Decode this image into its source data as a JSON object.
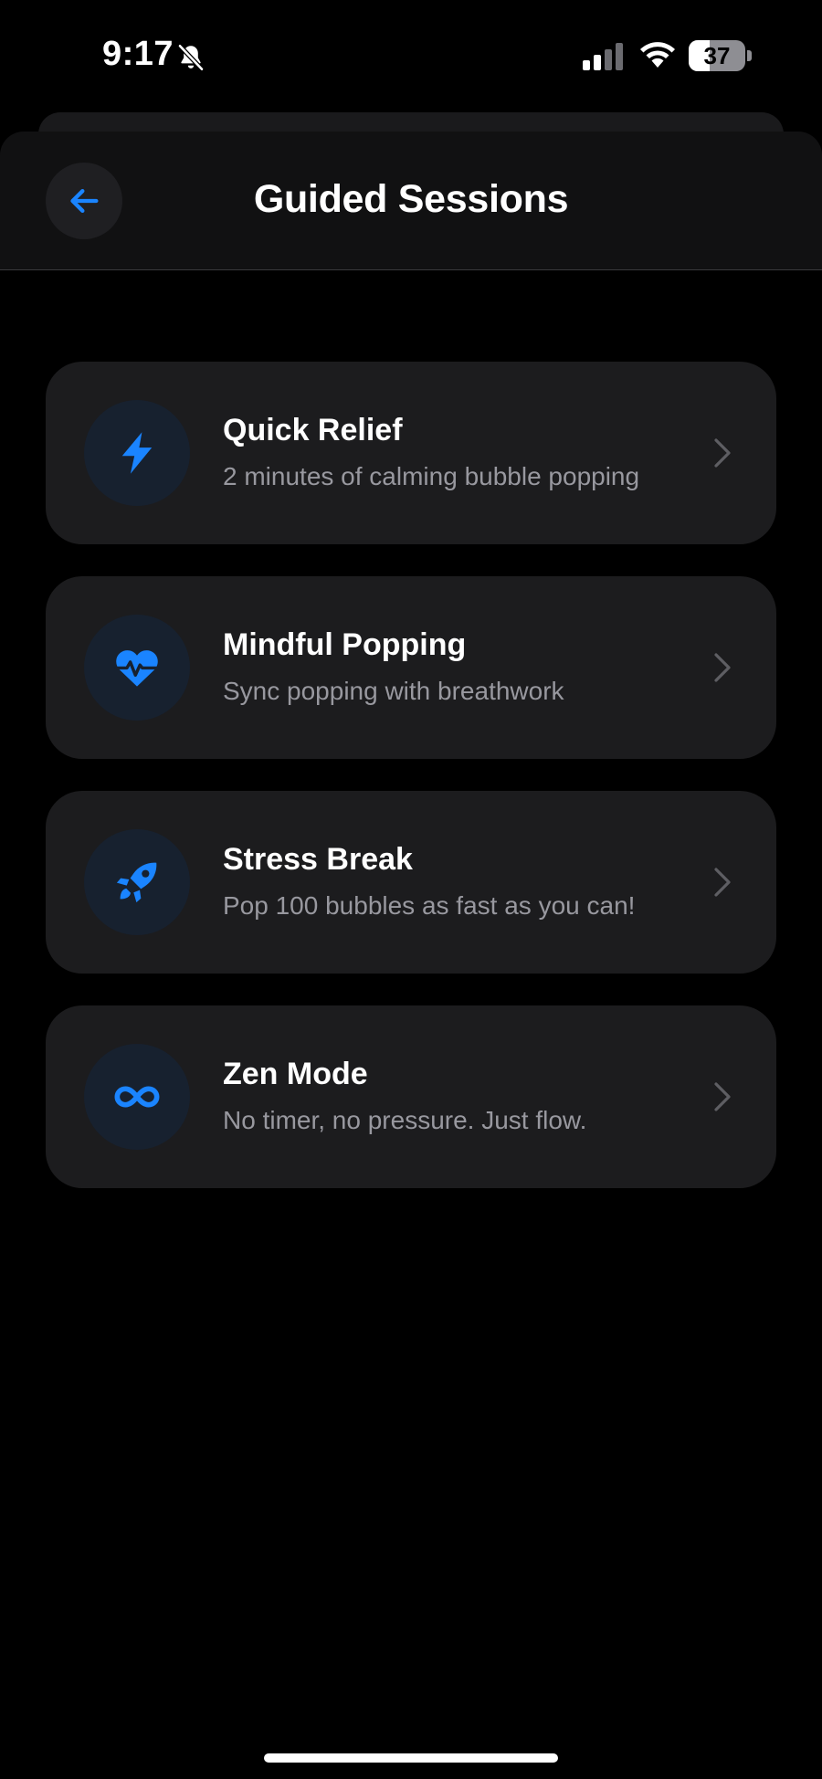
{
  "status_bar": {
    "time": "9:17",
    "battery_level": "37",
    "battery_percent": 37,
    "icons": [
      "bell-slash-icon",
      "cellular-signal-icon",
      "wifi-icon",
      "battery-icon"
    ]
  },
  "header": {
    "title": "Guided Sessions",
    "back_icon": "arrow-left-icon"
  },
  "sessions": [
    {
      "title": "Quick Relief",
      "subtitle": "2 minutes of calming bubble popping",
      "icon": "lightning-bolt-icon"
    },
    {
      "title": "Mindful Popping",
      "subtitle": "Sync popping with breathwork",
      "icon": "heart-pulse-icon"
    },
    {
      "title": "Stress Break",
      "subtitle": "Pop 100 bubbles as fast as you can!",
      "icon": "rocket-icon"
    },
    {
      "title": "Zen Mode",
      "subtitle": "No timer, no pressure. Just flow.",
      "icon": "infinity-icon"
    }
  ],
  "colors": {
    "accent": "#1a84ff",
    "background": "#000000",
    "card": "#1c1c1e",
    "subtitle": "#98989f",
    "icon_circle": "#17212f"
  }
}
